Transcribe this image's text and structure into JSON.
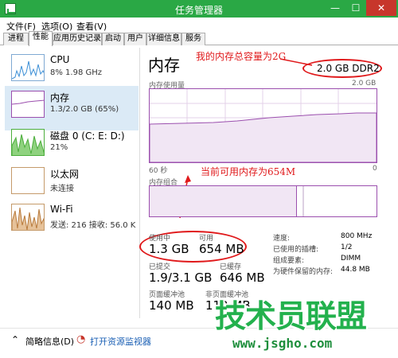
{
  "window": {
    "title": "任务管理器",
    "minimize": "—",
    "maximize": "☐",
    "close": "✕"
  },
  "menu": [
    "文件(F)",
    "选项(O)",
    "查看(V)"
  ],
  "tabs": [
    "进程",
    "性能",
    "应用历史记录",
    "启动",
    "用户",
    "详细信息",
    "服务"
  ],
  "sidebar": [
    {
      "name": "CPU",
      "value": "8% 1.98 GHz"
    },
    {
      "name": "内存",
      "value": "1.3/2.0 GB (65%)"
    },
    {
      "name": "磁盘 0 (C: E: D:)",
      "value": "21%"
    },
    {
      "name": "以太网",
      "value": "未连接"
    },
    {
      "name": "Wi-Fi",
      "value": "发送: 216 接收: 56.0 K"
    }
  ],
  "main": {
    "title": "内存",
    "capacity": "2.0 GB DDR2",
    "usage_label": "内存使用量",
    "usage_max": "2.0 GB",
    "time_label": "60 秒",
    "time_zero": "0",
    "composition_label": "内存组合",
    "in_use_fraction": 0.65
  },
  "annotations": {
    "top": "我的内存总容量为2G",
    "mid": "当前可用内存为654M"
  },
  "stats": {
    "in_use_label": "使用中",
    "in_use": "1.3 GB",
    "available_label": "可用",
    "available": "654 MB",
    "committed_label": "已提交",
    "committed": "1.9/3.1 GB",
    "cached_label": "已缓存",
    "cached": "646 MB",
    "paged_label": "页面缓冲池",
    "paged": "140 MB",
    "nonpaged_label": "非页面缓冲池",
    "nonpaged": "112 MB"
  },
  "details": [
    {
      "k": "速度:",
      "v": "800 MHz"
    },
    {
      "k": "已使用的插槽:",
      "v": "1/2"
    },
    {
      "k": "组成要素:",
      "v": "DIMM"
    },
    {
      "k": "为硬件保留的内存:",
      "v": "44.8 MB"
    }
  ],
  "footer": {
    "fewer": "简略信息(D)",
    "resmon": "打开资源监视器"
  },
  "watermark": {
    "text": "技术员联盟",
    "url": "www.jsgho.com"
  },
  "colors": {
    "titlebar": "#2aa845",
    "memory": "#9b4fae",
    "annotation": "#e0191b",
    "cpu": "#3c8fd6",
    "disk": "#4cae3c",
    "wifi": "#b87a3c"
  }
}
